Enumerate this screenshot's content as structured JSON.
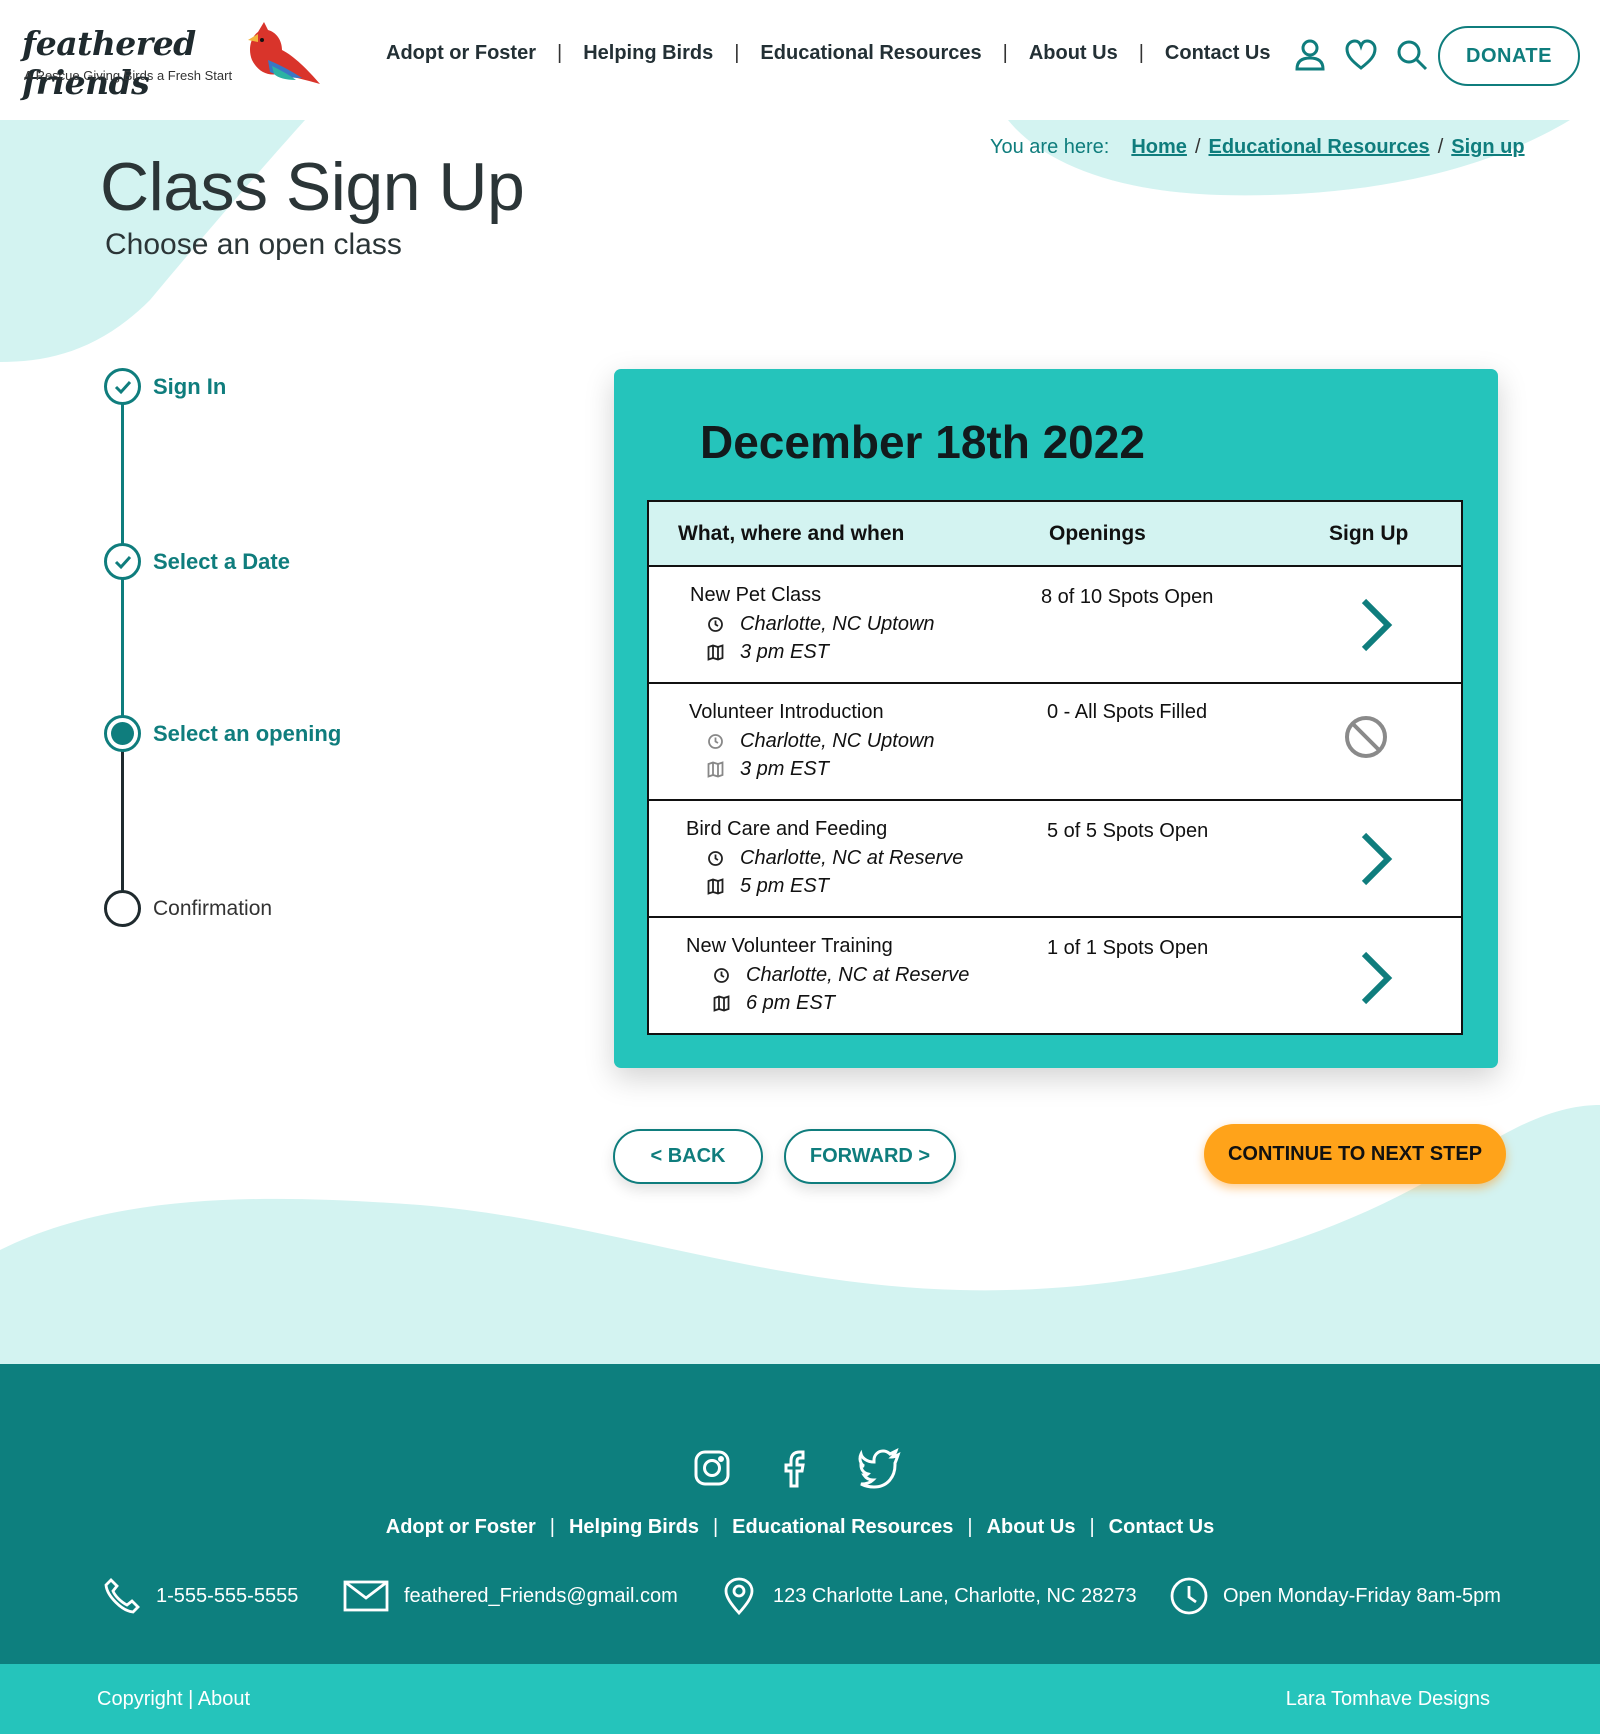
{
  "brand": {
    "name": "feathered friends",
    "tagline": "A Rescue Giving Birds a Fresh Start",
    "teal": "#0f7d7d",
    "light_teal": "#25c4bb",
    "pale_teal": "#d3f3f1",
    "orange": "#ffa31a"
  },
  "nav": {
    "items": [
      "Adopt or Foster",
      "Helping Birds",
      "Educational Resources",
      "About Us",
      "Contact Us"
    ],
    "icons": [
      "user-icon",
      "heart-icon",
      "search-icon"
    ],
    "donate_label": "DONATE"
  },
  "breadcrumb": {
    "label": "You are here:",
    "items": [
      "Home",
      "Educational Resources",
      "Sign up"
    ]
  },
  "page": {
    "title": "Class Sign Up",
    "subtitle": "Choose an open class"
  },
  "stepper": {
    "steps": [
      {
        "label": "Sign In",
        "state": "done"
      },
      {
        "label": "Select a Date",
        "state": "done"
      },
      {
        "label": "Select an opening",
        "state": "current"
      },
      {
        "label": "Confirmation",
        "state": "todo"
      }
    ]
  },
  "schedule": {
    "date": "December 18th 2022",
    "columns": [
      "What, where and when",
      "Openings",
      "Sign Up"
    ],
    "rows": [
      {
        "title": "New Pet Class",
        "location": "Charlotte, NC Uptown",
        "time": "3 pm EST",
        "openings": "8 of 10 Spots Open",
        "action": "chevron-right-icon"
      },
      {
        "title": "Volunteer Introduction",
        "location": "Charlotte, NC Uptown",
        "time": "3 pm EST",
        "openings": "0 - All Spots Filled",
        "action": "unavailable-icon"
      },
      {
        "title": "Bird Care and Feeding",
        "location": "Charlotte, NC at Reserve",
        "time": "5 pm EST",
        "openings": "5 of 5 Spots Open",
        "action": "chevron-right-icon"
      },
      {
        "title": "New Volunteer Training",
        "location": "Charlotte, NC at Reserve",
        "time": "6 pm EST",
        "openings": "1 of 1 Spots Open",
        "action": "chevron-right-icon"
      }
    ]
  },
  "actions": {
    "back": "< BACK",
    "forward": "FORWARD >",
    "continue": "CONTINUE TO NEXT STEP"
  },
  "footer": {
    "social": [
      "instagram-icon",
      "facebook-icon",
      "twitter-icon"
    ],
    "nav": [
      "Adopt or Foster",
      "Helping Birds",
      "Educational Resources",
      "About Us",
      "Contact Us"
    ],
    "phone": "1-555-555-5555",
    "email": "feathered_Friends@gmail.com",
    "address": "123 Charlotte Lane, Charlotte, NC 28273",
    "hours": "Open Monday-Friday 8am-5pm",
    "copyright": "Copyright | About",
    "credit": "Lara Tomhave Designs"
  }
}
